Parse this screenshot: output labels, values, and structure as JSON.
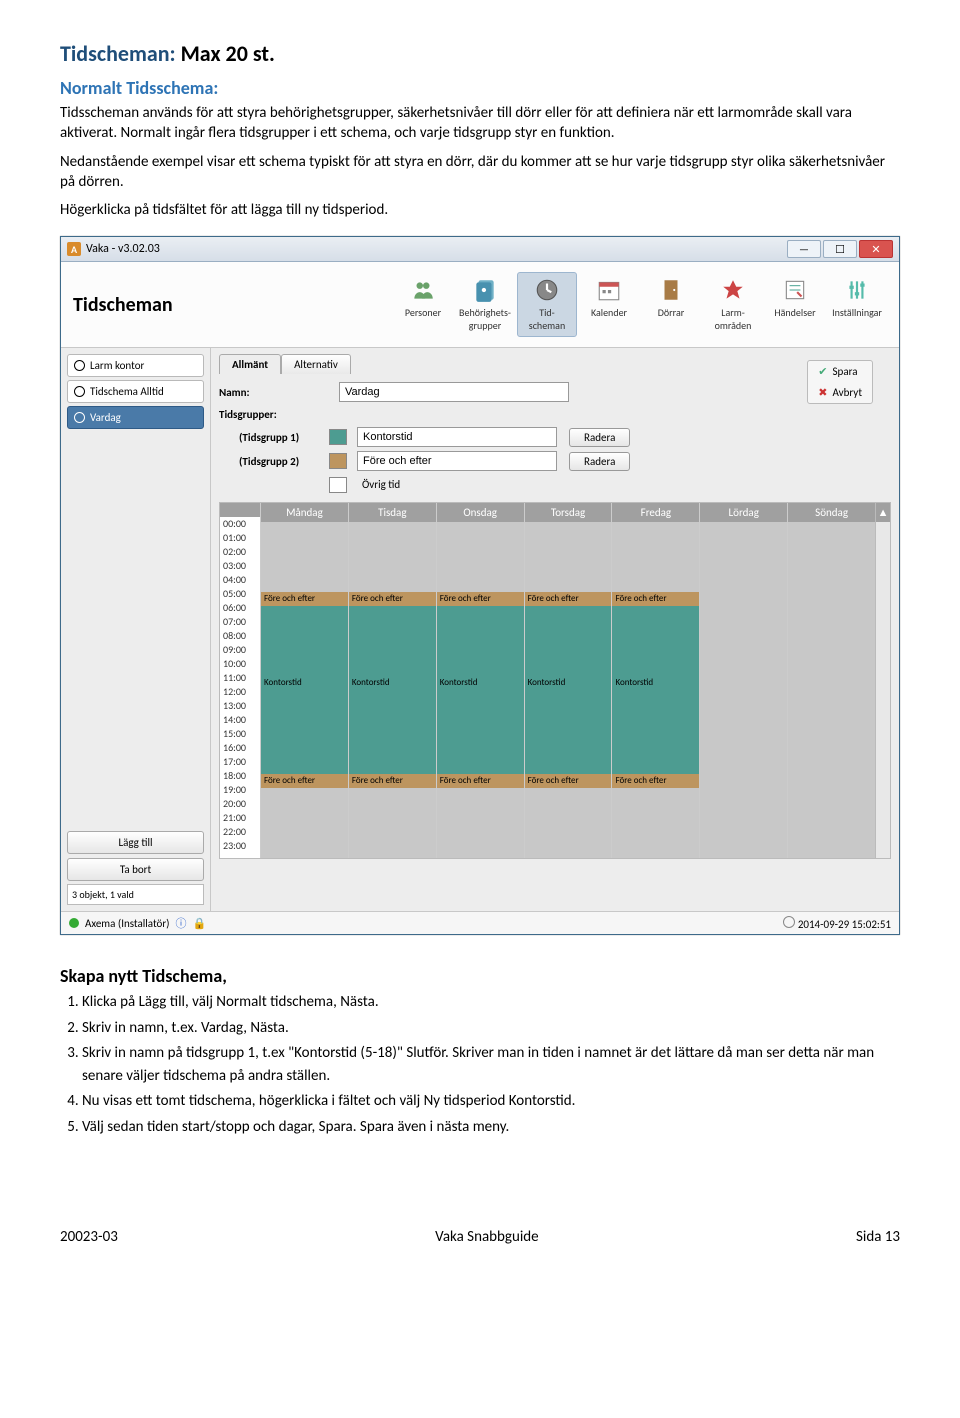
{
  "doc": {
    "title": "Tidscheman:",
    "title_suffix": " Max 20 st.",
    "subtitle": "Normalt Tidsschema:",
    "paragraph": "Tidsscheman används för att styra behörighetsgrupper, säkerhetsnivåer till dörr eller för att definiera när ett larmområde skall vara aktiverat. Normalt ingår flera tidsgrupper i ett schema, och varje tidsgrupp styr en funktion.",
    "paragraph2": "Nedanstående exempel visar ett schema typiskt för att styra en dörr, där du kommer att se hur varje tidsgrupp styr olika säkerhetsnivåer på dörren.",
    "paragraph3": "Högerklicka på tidsfältet för att lägga till ny tidsperiod.",
    "secondary_title": "Skapa nytt Tidschema,",
    "steps": [
      "Klicka på Lägg till, välj Normalt tidschema, Nästa.",
      "Skriv in namn, t.ex. Vardag, Nästa.",
      "Skriv in namn på tidsgrupp 1, t.ex \"Kontorstid (5-18)\" Slutför. Skriver man in tiden i namnet är det lättare då man ser detta när man senare väljer tidschema på andra ställen.",
      "Nu visas ett tomt tidschema, högerklicka i fältet och välj Ny tidsperiod Kontorstid.",
      "Välj sedan tiden start/stopp och dagar, Spara. Spara även i nästa meny."
    ],
    "footer_left": "20023-03",
    "footer_center": "Vaka Snabbguide",
    "footer_right": "Sida 13"
  },
  "app": {
    "window_title": "Vaka - v3.02.03",
    "header": "Tidscheman",
    "toolbar": [
      {
        "label": "Personer"
      },
      {
        "label": "Behörighets-\ngrupper"
      },
      {
        "label": "Tid-\nscheman",
        "selected": true
      },
      {
        "label": "Kalender"
      },
      {
        "label": "Dörrar"
      },
      {
        "label": "Larm-\nområden"
      },
      {
        "label": "Händelser"
      },
      {
        "label": "Inställningar"
      }
    ],
    "sidebar": {
      "items": [
        {
          "label": "Larm kontor"
        },
        {
          "label": "Tidschema Alltid"
        },
        {
          "label": "Vardag",
          "selected": true
        }
      ],
      "add_btn": "Lägg till",
      "remove_btn": "Ta bort",
      "count": "3 objekt, 1 vald"
    },
    "tabs": [
      {
        "label": "Allmänt",
        "active": true
      },
      {
        "label": "Alternativ"
      }
    ],
    "form": {
      "name_label": "Namn:",
      "name_value": "Vardag",
      "groups_label": "Tidsgrupper:",
      "group1_label": "(Tidsgrupp 1)",
      "group1_value": "Kontorstid",
      "group2_label": "(Tidsgrupp 2)",
      "group2_value": "Före och efter",
      "ovrig_label": "Övrig tid",
      "delete_btn": "Radera"
    },
    "actions": {
      "save": "Spara",
      "cancel": "Avbryt"
    },
    "schedule": {
      "days": [
        "Måndag",
        "Tisdag",
        "Onsdag",
        "Torsdag",
        "Fredag",
        "Lördag",
        "Söndag"
      ],
      "hours": [
        "00:00",
        "01:00",
        "02:00",
        "03:00",
        "04:00",
        "05:00",
        "06:00",
        "07:00",
        "08:00",
        "09:00",
        "10:00",
        "11:00",
        "12:00",
        "13:00",
        "14:00",
        "15:00",
        "16:00",
        "17:00",
        "18:00",
        "19:00",
        "20:00",
        "21:00",
        "22:00",
        "23:00"
      ],
      "fore_label": "Före och efter",
      "kontor_label": "Kontorstid"
    },
    "statusbar": {
      "user": "Axema (Installatör)",
      "timestamp": "2014-09-29 15:02:51"
    }
  }
}
